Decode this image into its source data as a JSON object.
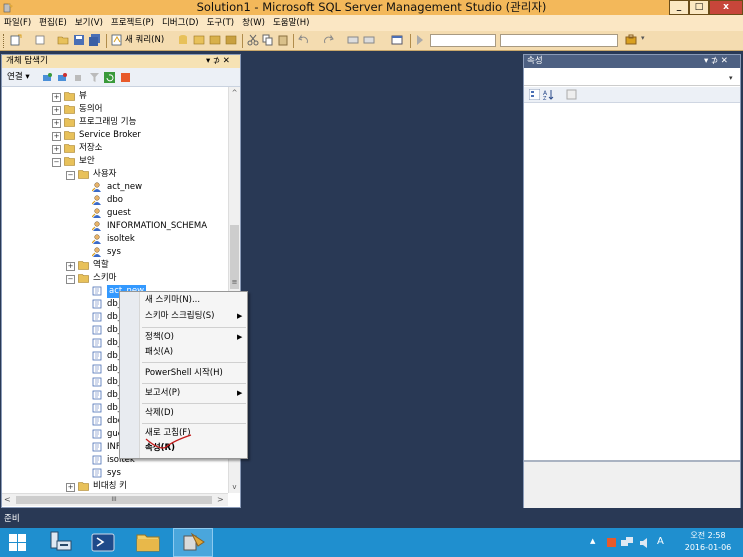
{
  "window": {
    "title": "Solution1 - Microsoft SQL Server Management Studio (관리자)",
    "min": "_",
    "max": "□",
    "close": "x"
  },
  "menu": [
    "파일(F)",
    "편집(E)",
    "보기(V)",
    "프로젝트(P)",
    "디버그(D)",
    "도구(T)",
    "창(W)",
    "도움말(H)"
  ],
  "toolbar": {
    "new_query": "새 쿼리(N)"
  },
  "object_explorer": {
    "title": "개체 탐색기",
    "title_controls": "▾ ⊅ ✕",
    "connect": "연결 ▾",
    "tree": [
      {
        "label": "뷰",
        "kind": "folder",
        "exp": "+",
        "level": 0
      },
      {
        "label": "동의어",
        "kind": "folder",
        "exp": "+",
        "level": 0
      },
      {
        "label": "프로그래밍 기능",
        "kind": "folder",
        "exp": "+",
        "level": 0
      },
      {
        "label": "Service Broker",
        "kind": "folder",
        "exp": "+",
        "level": 0
      },
      {
        "label": "저장소",
        "kind": "folder",
        "exp": "+",
        "level": 0
      },
      {
        "label": "보안",
        "kind": "folder",
        "exp": "−",
        "level": 0
      },
      {
        "label": "사용자",
        "kind": "folder",
        "exp": "−",
        "level": 1
      },
      {
        "label": "act_new",
        "kind": "user",
        "exp": "",
        "level": 2
      },
      {
        "label": "dbo",
        "kind": "user",
        "exp": "",
        "level": 2
      },
      {
        "label": "guest",
        "kind": "user",
        "exp": "",
        "level": 2
      },
      {
        "label": "INFORMATION_SCHEMA",
        "kind": "user",
        "exp": "",
        "level": 2
      },
      {
        "label": "isoltek",
        "kind": "user",
        "exp": "",
        "level": 2
      },
      {
        "label": "sys",
        "kind": "user",
        "exp": "",
        "level": 2
      },
      {
        "label": "역할",
        "kind": "folder",
        "exp": "+",
        "level": 1
      },
      {
        "label": "스키마",
        "kind": "folder",
        "exp": "−",
        "level": 1
      },
      {
        "label": "act_new",
        "kind": "schema",
        "exp": "",
        "level": 2
      },
      {
        "label": "db_",
        "kind": "schema",
        "exp": "",
        "level": 2
      },
      {
        "label": "db_",
        "kind": "schema",
        "exp": "",
        "level": 2
      },
      {
        "label": "db_",
        "kind": "schema",
        "exp": "",
        "level": 2
      },
      {
        "label": "db_",
        "kind": "schema",
        "exp": "",
        "level": 2
      },
      {
        "label": "db_",
        "kind": "schema",
        "exp": "",
        "level": 2
      },
      {
        "label": "db_",
        "kind": "schema",
        "exp": "",
        "level": 2
      },
      {
        "label": "db_",
        "kind": "schema",
        "exp": "",
        "level": 2
      },
      {
        "label": "db_",
        "kind": "schema",
        "exp": "",
        "level": 2
      },
      {
        "label": "db_",
        "kind": "schema",
        "exp": "",
        "level": 2
      },
      {
        "label": "dbo",
        "kind": "schema",
        "exp": "",
        "level": 2
      },
      {
        "label": "gue",
        "kind": "schema",
        "exp": "",
        "level": 2
      },
      {
        "label": "INF",
        "kind": "schema",
        "exp": "",
        "level": 2
      },
      {
        "label": "isoltek",
        "kind": "schema",
        "exp": "",
        "level": 2
      },
      {
        "label": "sys",
        "kind": "schema",
        "exp": "",
        "level": 2
      },
      {
        "label": "비대칭 키",
        "kind": "folder",
        "exp": "+",
        "level": 1
      }
    ]
  },
  "context_menu": {
    "items": [
      {
        "label": "새 스키마(N)...",
        "submenu": false
      },
      {
        "label": "스키마 스크립팅(S)",
        "submenu": true
      },
      {
        "label": "정책(O)",
        "submenu": true
      },
      {
        "label": "패싯(A)",
        "submenu": false
      },
      {
        "label": "PowerShell 시작(H)",
        "submenu": false
      },
      {
        "label": "보고서(P)",
        "submenu": true
      },
      {
        "label": "삭제(D)",
        "submenu": false
      },
      {
        "label": "새로 고침(F)",
        "submenu": false
      },
      {
        "label": "속성(R)",
        "submenu": false
      }
    ]
  },
  "properties": {
    "title": "속성",
    "title_controls": "▾ ⊅ ✕"
  },
  "statusbar": {
    "text": "준비"
  },
  "taskbar": {
    "time": "오전 2:58",
    "date": "2016-01-06",
    "ime": "A"
  },
  "colors": {
    "title_bar": "#f3b85a",
    "workspace": "#293955",
    "taskbar": "#1f8fcf",
    "folder": "#e8c15a"
  }
}
